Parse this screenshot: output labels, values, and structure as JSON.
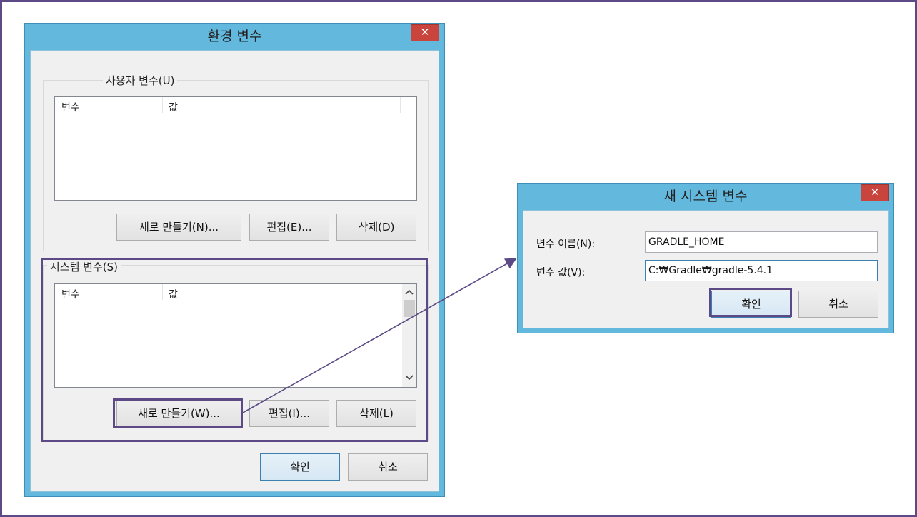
{
  "env_window": {
    "title": "환경 변수",
    "close_symbol": "✕",
    "user_group": {
      "label": "사용자 변수(U)",
      "columns": [
        "변수",
        "값"
      ],
      "buttons": {
        "new": "새로 만들기(N)...",
        "edit": "편집(E)...",
        "delete": "삭제(D)"
      }
    },
    "system_group": {
      "label": "시스템 변수(S)",
      "columns": [
        "변수",
        "값"
      ],
      "buttons": {
        "new": "새로 만들기(W)...",
        "edit": "편집(I)...",
        "delete": "삭제(L)"
      }
    },
    "footer": {
      "ok": "확인",
      "cancel": "취소"
    }
  },
  "new_var_dialog": {
    "title": "새 시스템 변수",
    "close_symbol": "✕",
    "name_label": "변수 이름(N):",
    "name_value": "GRADLE_HOME",
    "value_label": "변수 값(V):",
    "value_value": "C:₩Gradle₩gradle-5.4.1",
    "ok": "확인",
    "cancel": "취소"
  },
  "icons": {
    "scroll_up": "chevron-up-icon",
    "scroll_down": "chevron-down-icon"
  },
  "colors": {
    "highlight": "#5b4a86",
    "titlebar": "#63b8de",
    "close": "#c9443c"
  }
}
